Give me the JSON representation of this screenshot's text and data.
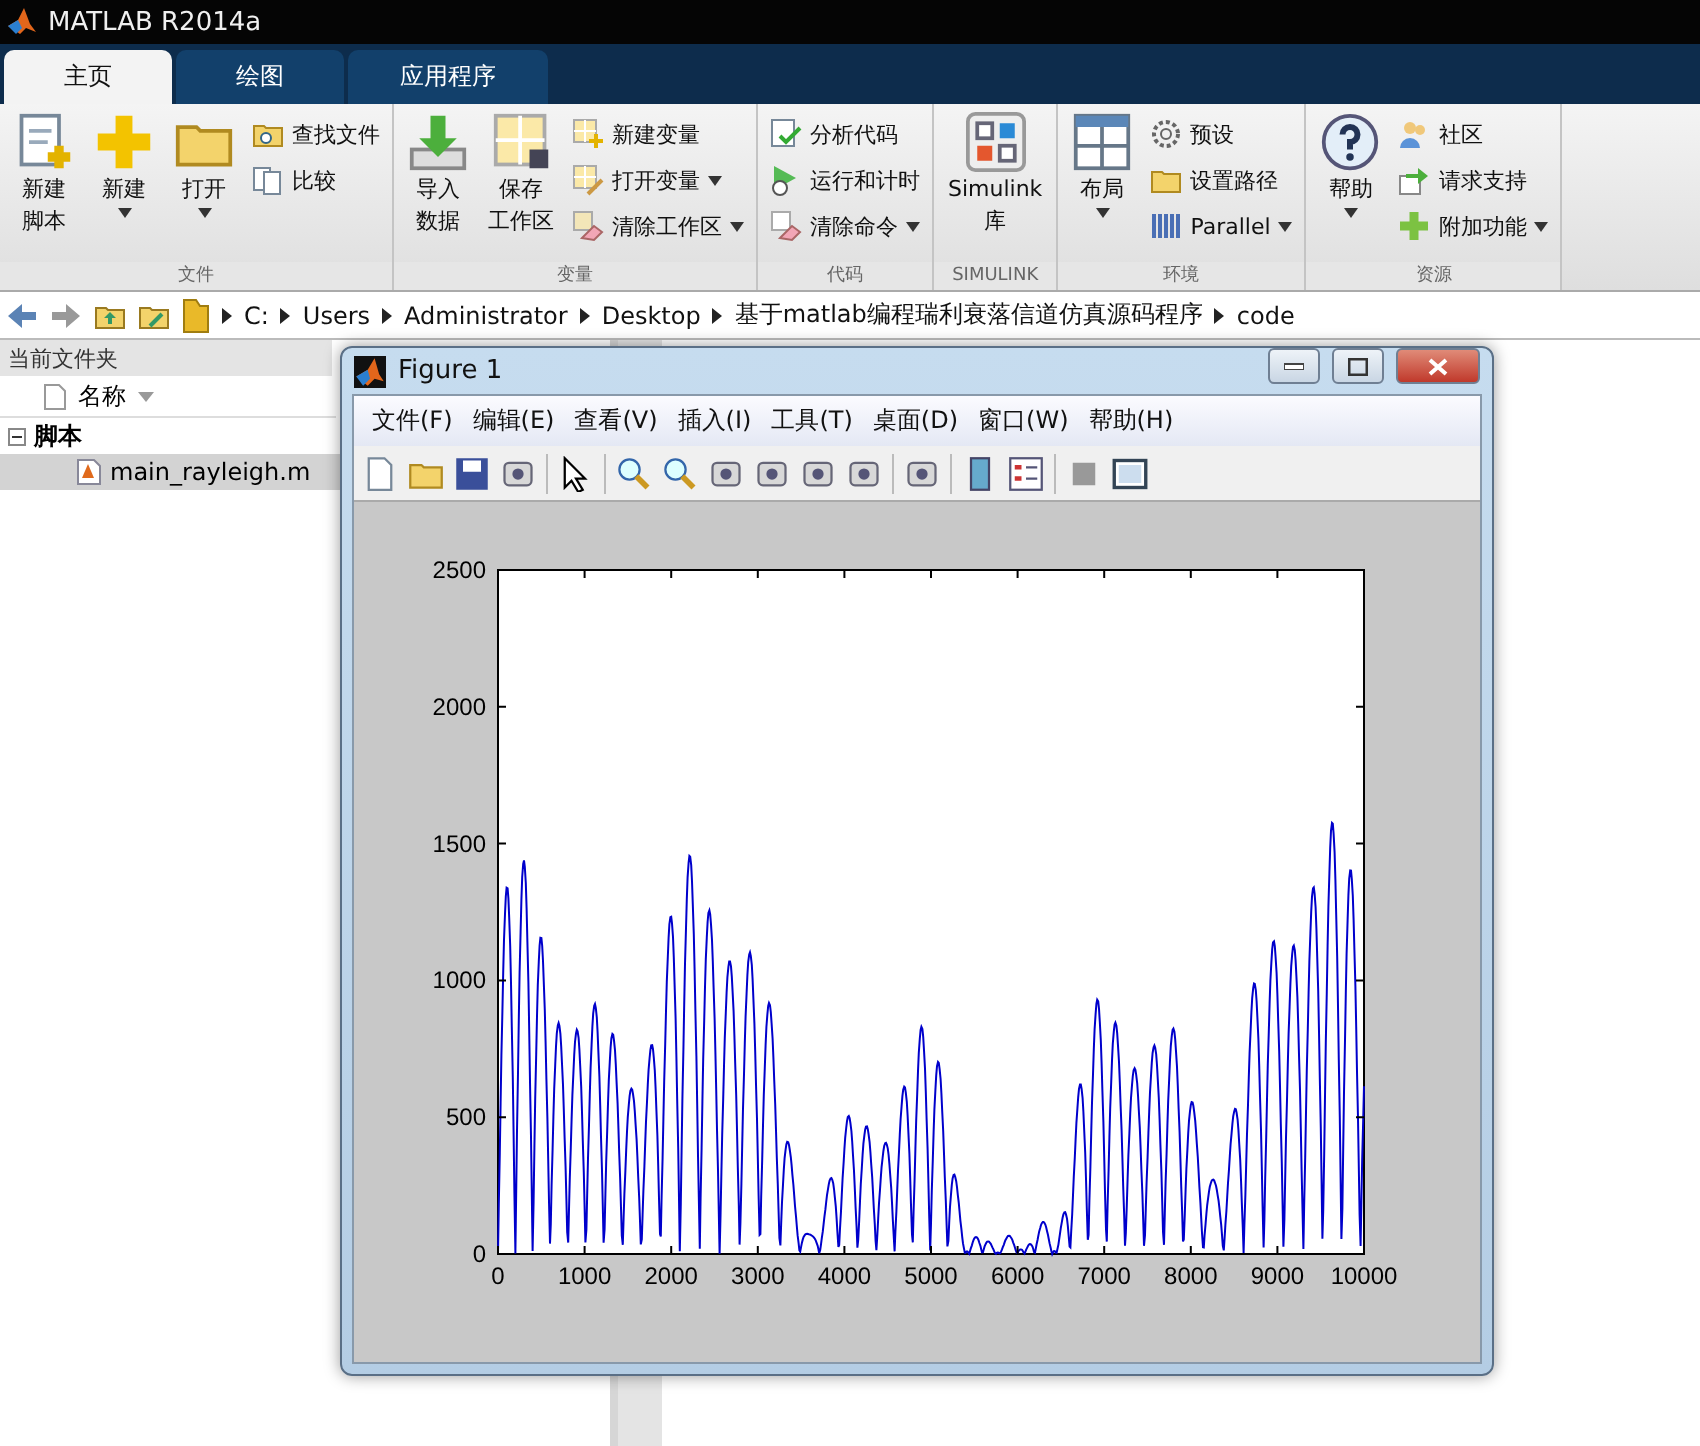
{
  "window": {
    "title": "MATLAB R2014a"
  },
  "tabs": [
    {
      "label": "主页",
      "selected": true
    },
    {
      "label": "绘图",
      "selected": false
    },
    {
      "label": "应用程序",
      "selected": false
    }
  ],
  "ribbon": {
    "groups": [
      {
        "label": "文件",
        "items": [
          {
            "kind": "large",
            "lines": [
              "新建",
              "脚本"
            ],
            "dropdown": false
          },
          {
            "kind": "large",
            "lines": [
              "新建"
            ],
            "dropdown": true
          },
          {
            "kind": "large",
            "lines": [
              "打开"
            ],
            "dropdown": true
          },
          {
            "kind": "small",
            "lines": [
              "查找文件"
            ],
            "dropdown": false
          },
          {
            "kind": "small",
            "lines": [
              "比较"
            ],
            "dropdown": false
          }
        ]
      },
      {
        "label": "变量",
        "items": [
          {
            "kind": "large",
            "lines": [
              "导入",
              "数据"
            ],
            "dropdown": false
          },
          {
            "kind": "large",
            "lines": [
              "保存",
              "工作区"
            ],
            "dropdown": false
          },
          {
            "kind": "small",
            "lines": [
              "新建变量"
            ],
            "dropdown": false
          },
          {
            "kind": "small",
            "lines": [
              "打开变量"
            ],
            "dropdown": true
          },
          {
            "kind": "small",
            "lines": [
              "清除工作区"
            ],
            "dropdown": true
          }
        ]
      },
      {
        "label": "代码",
        "items": [
          {
            "kind": "small",
            "lines": [
              "分析代码"
            ],
            "dropdown": false
          },
          {
            "kind": "small",
            "lines": [
              "运行和计时"
            ],
            "dropdown": false
          },
          {
            "kind": "small",
            "lines": [
              "清除命令"
            ],
            "dropdown": true
          }
        ]
      },
      {
        "label": "SIMULINK",
        "items": [
          {
            "kind": "large",
            "lines": [
              "Simulink",
              "库"
            ],
            "dropdown": false
          }
        ]
      },
      {
        "label": "环境",
        "items": [
          {
            "kind": "large",
            "lines": [
              "布局"
            ],
            "dropdown": true
          },
          {
            "kind": "small",
            "lines": [
              "预设"
            ],
            "dropdown": false
          },
          {
            "kind": "small",
            "lines": [
              "设置路径"
            ],
            "dropdown": false
          },
          {
            "kind": "small",
            "lines": [
              "Parallel"
            ],
            "dropdown": true
          }
        ]
      },
      {
        "label": "资源",
        "items": [
          {
            "kind": "large",
            "lines": [
              "帮助"
            ],
            "dropdown": true
          },
          {
            "kind": "small",
            "lines": [
              "社区"
            ],
            "dropdown": false
          },
          {
            "kind": "small",
            "lines": [
              "请求支持"
            ],
            "dropdown": false
          },
          {
            "kind": "small",
            "lines": [
              "附加功能"
            ],
            "dropdown": true
          }
        ]
      }
    ]
  },
  "address_bar": {
    "path": [
      "C:",
      "Users",
      "Administrator",
      "Desktop",
      "基于matlab编程瑞利衰落信道仿真源码程序",
      "code"
    ]
  },
  "current_folder": {
    "title": "当前文件夹",
    "column": "名称",
    "tree": [
      {
        "label": "脚本",
        "expanded": true,
        "selected": false,
        "children": [
          {
            "label": "main_rayleigh.m",
            "selected": true
          }
        ]
      }
    ]
  },
  "figure": {
    "title": "Figure 1",
    "menu": [
      "文件(F)",
      "编辑(E)",
      "查看(V)",
      "插入(I)",
      "工具(T)",
      "桌面(D)",
      "窗口(W)",
      "帮助(H)"
    ],
    "axes": {
      "xticks": [
        "0",
        "1000",
        "2000",
        "3000",
        "4000",
        "5000",
        "6000",
        "7000",
        "8000",
        "9000",
        "10000"
      ],
      "yticks": [
        "2500",
        "2000",
        "1500",
        "1000",
        "500",
        "0"
      ]
    }
  }
}
